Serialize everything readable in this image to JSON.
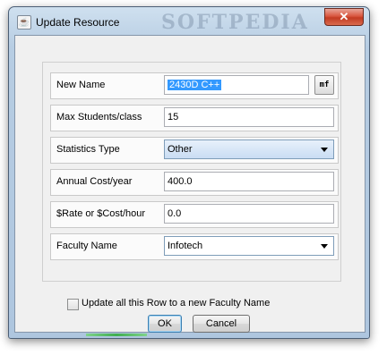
{
  "window": {
    "title": "Update Resource",
    "watermark": "SOFTPEDIA",
    "close_glyph": "✕",
    "app_icon": "java-cup-icon"
  },
  "form": {
    "new_name": {
      "label": "New Name",
      "value": "2430D C++",
      "mf_button": "mf"
    },
    "max_students": {
      "label": "Max Students/class",
      "value": "15"
    },
    "statistics_type": {
      "label": "Statistics Type",
      "selected": "Other"
    },
    "annual_cost": {
      "label": "Annual Cost/year",
      "value": "400.0"
    },
    "rate_cost": {
      "label": "$Rate or $Cost/hour",
      "value": "0.0"
    },
    "faculty_name": {
      "label": "Faculty Name",
      "selected": "Infotech"
    },
    "update_all": {
      "label": "Update all this Row to a new Faculty Name",
      "checked": false
    }
  },
  "buttons": {
    "ok": "OK",
    "cancel": "Cancel"
  },
  "colors": {
    "selection": "#3399ff",
    "dialog_bg": "#f0f0f0",
    "titlebar": "#b7cde3",
    "close_button": "#c23b22"
  }
}
